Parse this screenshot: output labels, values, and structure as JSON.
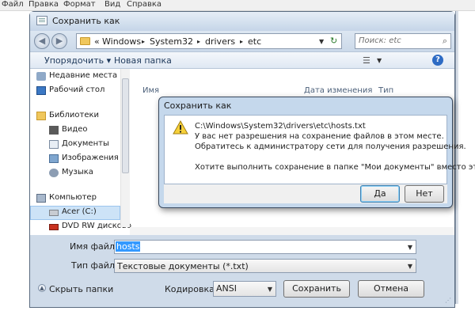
{
  "menubar": {
    "items": [
      "Файл",
      "Правка",
      "Формат",
      "Вид",
      "Справка"
    ]
  },
  "dialog": {
    "title": "Сохранить как",
    "breadcrumb": {
      "prefix": "«",
      "parts": [
        "Windows",
        "System32",
        "drivers",
        "etc"
      ],
      "separator": "▸"
    },
    "search_placeholder": "Поиск: etc",
    "toolbar": {
      "organize": "Упорядочить ▾",
      "new_folder": "Новая папка"
    },
    "columns": {
      "name": "Имя",
      "date": "Дата изменения",
      "type": "Тип"
    },
    "nav": [
      {
        "label": "Недавние места",
        "icon": "recent-places-icon"
      },
      {
        "label": "Рабочий стол",
        "icon": "desktop-icon"
      },
      {
        "label": "Библиотеки",
        "icon": "libraries-icon"
      },
      {
        "label": "Видео",
        "icon": "video-icon"
      },
      {
        "label": "Документы",
        "icon": "documents-icon"
      },
      {
        "label": "Изображения",
        "icon": "pictures-icon"
      },
      {
        "label": "Музыка",
        "icon": "music-icon"
      },
      {
        "label": "Компьютер",
        "icon": "computer-icon"
      },
      {
        "label": "Acer (C:)",
        "icon": "drive-icon"
      },
      {
        "label": "DVD RW дисково",
        "icon": "dvd-drive-icon"
      }
    ],
    "filename_label": "Имя файла:",
    "filename_value": "hosts",
    "filetype_label": "Тип файла:",
    "filetype_value": "Текстовые документы (*.txt)",
    "hide_folders": "Скрыть папки",
    "encoding_label": "Кодировка:",
    "encoding_value": "ANSI",
    "save_button": "Сохранить",
    "cancel_button": "Отмена"
  },
  "alert": {
    "title": "Сохранить как",
    "path": "C:\\Windows\\System32\\drivers\\etc\\hosts.txt",
    "line1": "У вас нет разрешения на сохранение файлов в этом месте.",
    "line2": "Обратитесь к администратору сети для получения разрешения.",
    "question": "Хотите выполнить сохранение в папке \"Мои документы\" вместо этого?",
    "yes_button": "Да",
    "no_button": "Нет"
  },
  "colors": {
    "accent": "#3399ff",
    "frame": "#cfdbe9",
    "selection": "#cde3f7"
  }
}
